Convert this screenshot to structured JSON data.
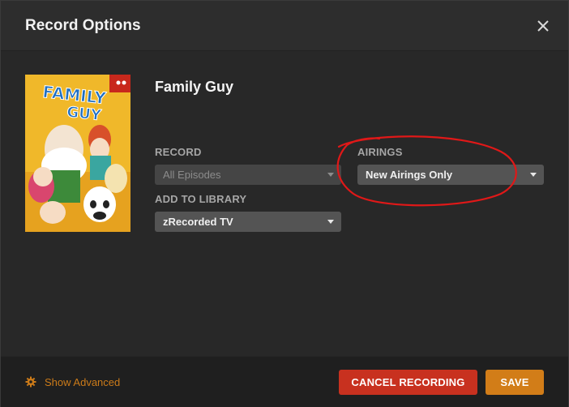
{
  "dialog": {
    "title": "Record Options",
    "close_icon": "close-icon"
  },
  "show": {
    "title": "Family Guy",
    "poster_text_line1": "FAMILY",
    "poster_text_line2": "GUY",
    "poster_badge_icon": "recording-badge-icon"
  },
  "record": {
    "label": "RECORD",
    "value": "All Episodes",
    "enabled": false
  },
  "library": {
    "label": "ADD TO LIBRARY",
    "value": "zRecorded TV"
  },
  "airings": {
    "label": "AIRINGS",
    "value": "New Airings Only"
  },
  "annotation": {
    "color": "#e01818"
  },
  "footer": {
    "advanced_label": "Show Advanced",
    "advanced_icon": "gear-icon",
    "cancel_label": "CANCEL RECORDING",
    "save_label": "SAVE"
  },
  "colors": {
    "accent": "#cc7b19",
    "cancel": "#c8311f",
    "save": "#d27d18"
  }
}
